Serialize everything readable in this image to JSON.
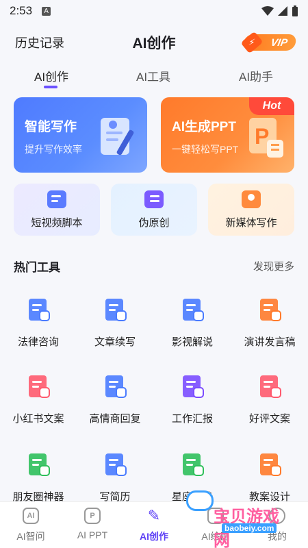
{
  "status": {
    "time": "2:53",
    "notif": "A"
  },
  "header": {
    "history": "历史记录",
    "title": "AI创作",
    "vip": "VIP"
  },
  "tabs": [
    {
      "label": "AI创作",
      "active": true
    },
    {
      "label": "AI工具",
      "active": false
    },
    {
      "label": "AI助手",
      "active": false
    }
  ],
  "feature_cards": [
    {
      "title": "智能写作",
      "subtitle": "提升写作效率",
      "icon": "document-pen-icon"
    },
    {
      "title": "AI生成PPT",
      "subtitle": "一键轻松写PPT",
      "badge": "Hot",
      "icon": "ppt-icon"
    }
  ],
  "quick_cards": [
    {
      "label": "短视频脚本",
      "icon": "video-script-icon"
    },
    {
      "label": "伪原创",
      "icon": "rewrite-icon"
    },
    {
      "label": "新媒体写作",
      "icon": "new-media-icon"
    }
  ],
  "hot_tools": {
    "title": "热门工具",
    "more": "发现更多",
    "items": [
      {
        "label": "法律咨询",
        "icon": "law-icon",
        "color": "#4a7bff"
      },
      {
        "label": "文章续写",
        "icon": "article-continue-icon",
        "color": "#4a7bff"
      },
      {
        "label": "影视解说",
        "icon": "film-icon",
        "color": "#4a7bff"
      },
      {
        "label": "演讲发言稿",
        "icon": "speech-icon",
        "color": "#ff7a2b"
      },
      {
        "label": "小红书文案",
        "icon": "xiaohongshu-icon",
        "color": "#ff5a6e"
      },
      {
        "label": "高情商回复",
        "icon": "reply-icon",
        "color": "#4a7bff"
      },
      {
        "label": "工作汇报",
        "icon": "briefcase-icon",
        "color": "#7b4dff"
      },
      {
        "label": "好评文案",
        "icon": "heart-doc-icon",
        "color": "#ff5a6e"
      },
      {
        "label": "朋友圈神器",
        "icon": "moments-icon",
        "color": "#2fbf5b"
      },
      {
        "label": "写简历",
        "icon": "resume-icon",
        "color": "#4a7bff"
      },
      {
        "label": "星座运势",
        "icon": "star-icon",
        "color": "#2fbf5b"
      },
      {
        "label": "教案设计",
        "icon": "lesson-icon",
        "color": "#ff7a2b"
      }
    ]
  },
  "bottom_nav": [
    {
      "label": "AI智问",
      "icon_text": "AI",
      "active": false
    },
    {
      "label": "AI PPT",
      "icon_text": "P",
      "active": false
    },
    {
      "label": "AI创作",
      "icon_text": "✎",
      "active": true
    },
    {
      "label": "AI绘画",
      "icon_text": "",
      "active": false
    },
    {
      "label": "我的",
      "icon_text": "",
      "active": false
    }
  ],
  "watermark": {
    "main": "宝贝游戏网",
    "sub": "baobeiy.com"
  },
  "colors": {
    "accent": "#5b3ef5",
    "blue": "#4f7bff",
    "orange": "#ff7a2b"
  }
}
